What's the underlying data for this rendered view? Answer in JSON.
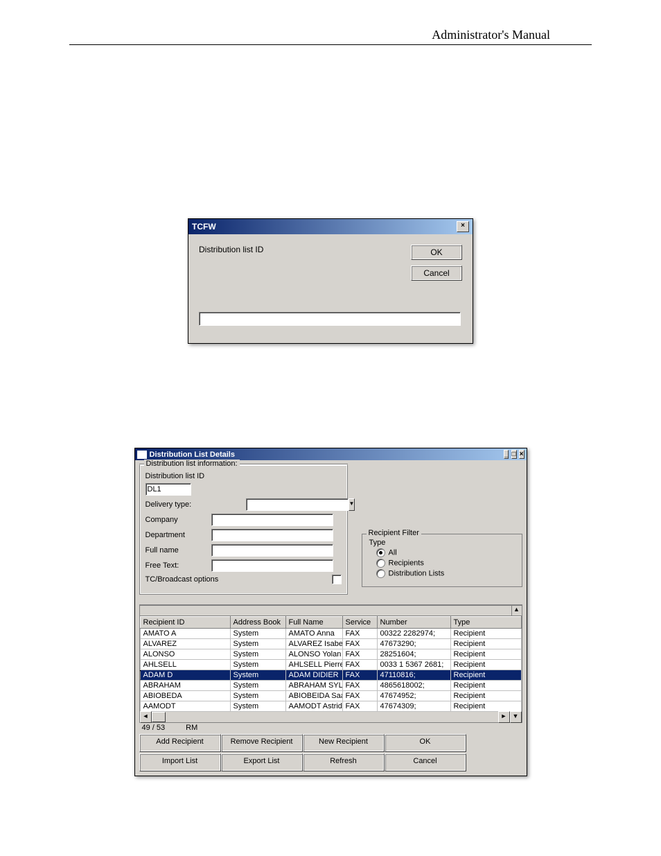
{
  "header": {
    "title": "Administrator's Manual"
  },
  "dialog1": {
    "title": "TCFW",
    "label": "Distribution list ID",
    "ok": "OK",
    "cancel": "Cancel",
    "input_value": ""
  },
  "dialog2": {
    "title": "Distribution List Details",
    "group_label": "Distribution list information:",
    "fields": {
      "dl_id_label": "Distribution list ID",
      "dl_id_value": "DL1",
      "delivery_type_label": "Delivery type:",
      "delivery_type_value": "",
      "company_label": "Company",
      "company_value": "",
      "department_label": "Department",
      "department_value": "",
      "fullname_label": "Full name",
      "fullname_value": "",
      "freetext_label": "Free Text:",
      "freetext_value": "",
      "tcbroadcast_label": "TC/Broadcast options"
    },
    "filter": {
      "group_label": "Recipient Filter",
      "type_label": "Type",
      "opt_all": "All",
      "opt_recipients": "Recipients",
      "opt_dls": "Distribution Lists",
      "selected": "All"
    },
    "columns": [
      "Recipient ID",
      "Address Book",
      "Full Name",
      "Service",
      "Number",
      "Type"
    ],
    "rows": [
      {
        "id": "AMATO A",
        "book": "System",
        "name": "AMATO Anna",
        "svc": "FAX",
        "num": "00322 2282974;",
        "type": "Recipient",
        "sel": false
      },
      {
        "id": "ALVAREZ",
        "book": "System",
        "name": "ALVAREZ Isabe",
        "svc": "FAX",
        "num": "47673290;",
        "type": "Recipient",
        "sel": false
      },
      {
        "id": "ALONSO",
        "book": "System",
        "name": "ALONSO Yolan",
        "svc": "FAX",
        "num": "28251604;",
        "type": "Recipient",
        "sel": false
      },
      {
        "id": "AHLSELL",
        "book": "System",
        "name": "AHLSELL Pierre",
        "svc": "FAX",
        "num": "0033 1 5367 2681;",
        "type": "Recipient",
        "sel": false
      },
      {
        "id": "ADAM D",
        "book": "System",
        "name": "ADAM  DIDIER",
        "svc": "FAX",
        "num": "47110816;",
        "type": "Recipient",
        "sel": true
      },
      {
        "id": "ABRAHAM",
        "book": "System",
        "name": "ABRAHAM  SYL",
        "svc": "FAX",
        "num": "4865618002;",
        "type": "Recipient",
        "sel": false
      },
      {
        "id": "ABIOBEDA",
        "book": "System",
        "name": "ABIOBEIDA Saa",
        "svc": "FAX",
        "num": "47674952;",
        "type": "Recipient",
        "sel": false
      },
      {
        "id": "AAMODT",
        "book": "System",
        "name": "AAMODT Astrid",
        "svc": "FAX",
        "num": "47674309;",
        "type": "Recipient",
        "sel": false
      }
    ],
    "status": {
      "count": "49 / 53",
      "mode": "RM"
    },
    "buttons": {
      "add": "Add Recipient",
      "remove": "Remove Recipient",
      "new": "New Recipient",
      "ok": "OK",
      "import": "Import List",
      "export": "Export List",
      "refresh": "Refresh",
      "cancel": "Cancel"
    }
  }
}
